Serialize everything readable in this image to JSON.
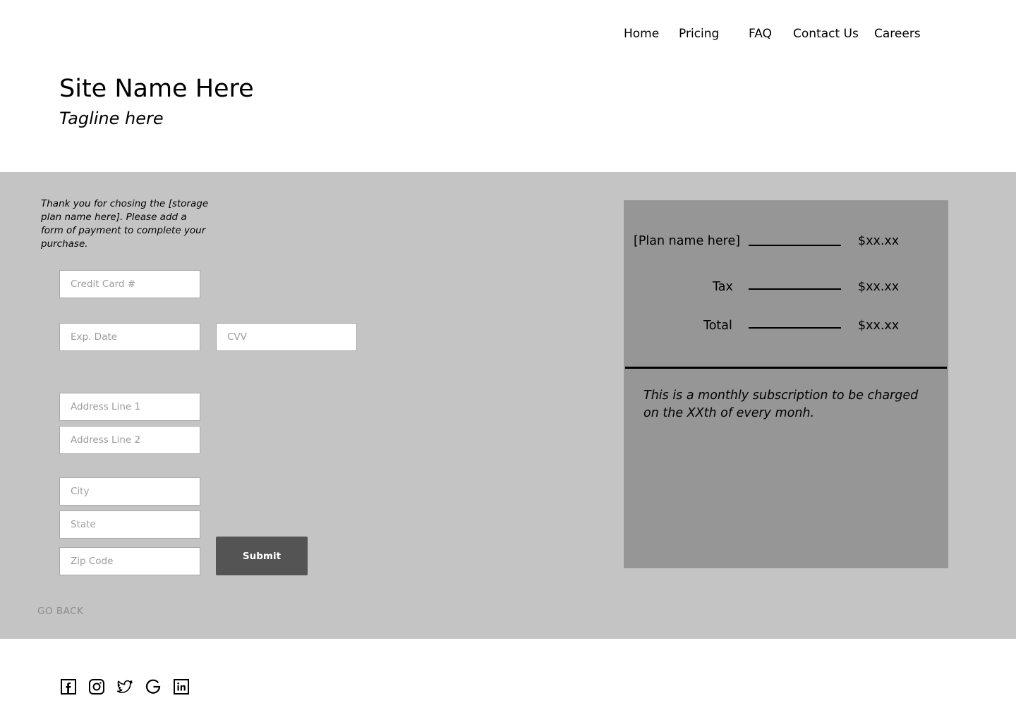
{
  "nav": {
    "items": [
      {
        "label": "Home"
      },
      {
        "label": "Pricing"
      },
      {
        "label": "FAQ"
      },
      {
        "label": "Contact Us"
      },
      {
        "label": "Careers"
      }
    ]
  },
  "header": {
    "site_name": "Site Name Here",
    "tagline": "Tagline here"
  },
  "checkout": {
    "intro": "Thank you for chosing the [storage plan name here]. Please add a form of payment to complete your purchase.",
    "fields": {
      "card_placeholder": "Credit Card #",
      "exp_placeholder": "Exp. Date",
      "cvv_placeholder": "CVV",
      "address1_placeholder": "Address Line 1",
      "address2_placeholder": "Address Line 2",
      "city_placeholder": "City",
      "state_placeholder": "State",
      "zip_placeholder": "Zip Code"
    },
    "submit_label": "Submit",
    "go_back_label": "GO BACK"
  },
  "summary": {
    "rows": [
      {
        "label": "[Plan name here]",
        "price": "$xx.xx"
      },
      {
        "label": "Tax",
        "price": "$xx.xx"
      },
      {
        "label": "Total",
        "price": "$xx.xx"
      }
    ],
    "note": "This is a monthly subscription to be charged on the XXth of every monh."
  },
  "footer": {
    "social_icons": [
      "facebook-icon",
      "instagram-icon",
      "twitter-icon",
      "google-icon",
      "linkedin-icon"
    ]
  }
}
